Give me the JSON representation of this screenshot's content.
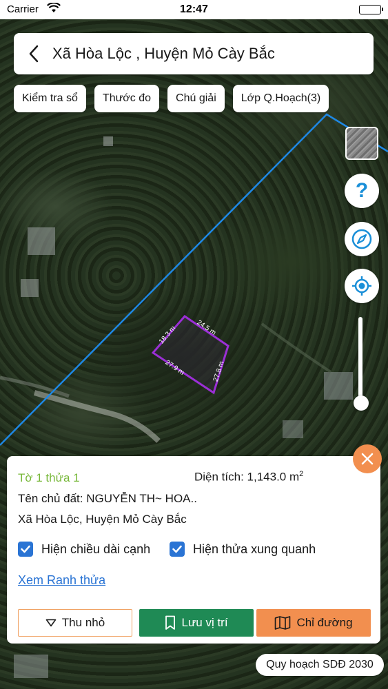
{
  "status_bar": {
    "carrier": "Carrier",
    "time": "12:47"
  },
  "header": {
    "title": "Xã Hòa Lộc , Huyện Mỏ Cày Bắc"
  },
  "chips": [
    {
      "label": "Kiểm tra sổ"
    },
    {
      "label": "Thước đo"
    },
    {
      "label": "Chú giải"
    },
    {
      "label": "Lớp Q.Hoạch(3)"
    }
  ],
  "map": {
    "edge_labels": [
      "18.3 m",
      "24.5 m",
      "27.9 m",
      "27.8 m"
    ],
    "parcel_color": "#9b2fd6",
    "boundary_color": "#1e88e5"
  },
  "controls": {
    "help_icon": "question-icon",
    "compass_icon": "compass-icon",
    "locate_icon": "crosshair-icon",
    "zoom_level": 0.9
  },
  "panel": {
    "parcel_id": "Tờ 1 thửa 1",
    "area_prefix": "Diện tích: 1,143.0 m",
    "area_sup": "2",
    "owner": "Tên chủ đất: NGUYỄN TH~ HOA..",
    "address": "Xã Hòa Lộc, Huyện Mỏ Cày Bắc",
    "check_edges_label": "Hiện chiều dài cạnh",
    "check_neighbors_label": "Hiện thửa xung quanh",
    "check_edges_checked": true,
    "check_neighbors_checked": true,
    "link_label": "Xem Ranh thửa",
    "collapse_label": "Thu nhỏ",
    "save_label": "Lưu vị trí",
    "directions_label": "Chỉ đường"
  },
  "bottom_chip": {
    "label": "Quy hoạch SDĐ 2030"
  },
  "colors": {
    "accent_orange": "#f28f4f",
    "save_green": "#1f8a55",
    "checkbox_blue": "#2a74d4",
    "parcel_id_green": "#78b83a"
  }
}
